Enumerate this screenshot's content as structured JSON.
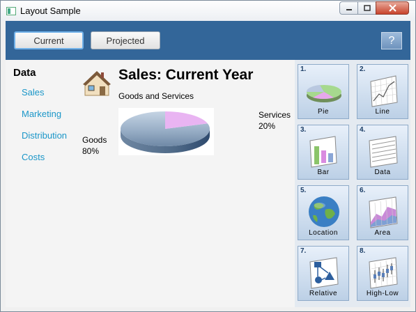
{
  "window": {
    "title": "Layout Sample"
  },
  "toolbar": {
    "current_label": "Current",
    "projected_label": "Projected",
    "help_label": "?"
  },
  "sidebar": {
    "title": "Data",
    "links": [
      {
        "label": "Sales"
      },
      {
        "label": "Marketing"
      },
      {
        "label": "Distribution"
      },
      {
        "label": "Costs"
      }
    ]
  },
  "main": {
    "title": "Sales:  Current Year",
    "subtitle": "Goods and Services",
    "goods_name": "Goods",
    "goods_pct": "80%",
    "services_name": "Services",
    "services_pct": "20%"
  },
  "pie": {
    "goods_fraction": 0.8,
    "services_fraction": 0.2,
    "goods_color": "#7f9bb8",
    "services_color": "#e9aef0"
  },
  "tiles": [
    {
      "num": "1.",
      "label": "Pie",
      "icon": "pie-chart-icon"
    },
    {
      "num": "2.",
      "label": "Line",
      "icon": "line-chart-icon"
    },
    {
      "num": "3.",
      "label": "Bar",
      "icon": "bar-chart-icon"
    },
    {
      "num": "4.",
      "label": "Data",
      "icon": "data-sheet-icon"
    },
    {
      "num": "5.",
      "label": "Location",
      "icon": "globe-icon"
    },
    {
      "num": "6.",
      "label": "Area",
      "icon": "area-chart-icon"
    },
    {
      "num": "7.",
      "label": "Relative",
      "icon": "flowchart-icon"
    },
    {
      "num": "8.",
      "label": "High-Low",
      "icon": "high-low-chart-icon"
    }
  ],
  "colors": {
    "toolbar": "#336699",
    "link": "#1a96c8"
  }
}
